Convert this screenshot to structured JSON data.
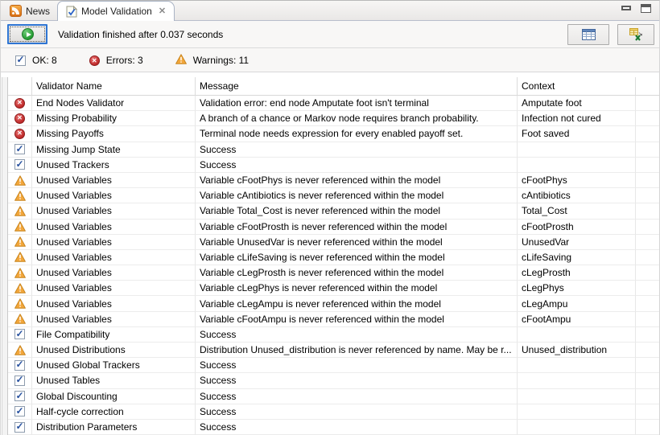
{
  "colors": {
    "focus_blue": "#2E75D3",
    "error_red": "#BE2929",
    "warning_orange": "#F3A73B",
    "ok_check_navy": "#27519F",
    "panel_bg": "#F8F7F6"
  },
  "icons": {
    "ok": "ok-checkbox-icon",
    "error": "error-icon",
    "warning": "warning-icon"
  },
  "tabs": {
    "news": {
      "label": "News"
    },
    "model_validation": {
      "label": "Model Validation"
    }
  },
  "toolbar": {
    "status_text": "Validation finished after 0.037 seconds"
  },
  "summary": {
    "ok_label": "OK: 8",
    "errors_label": "Errors: 3",
    "warnings_label": "Warnings: 11"
  },
  "table": {
    "columns": [
      "Validator Name",
      "Message",
      "Context"
    ],
    "rows": [
      {
        "status": "error",
        "name": "End Nodes Validator",
        "message": "Validation error: end node Amputate foot isn't terminal",
        "context": "Amputate foot"
      },
      {
        "status": "error",
        "name": "Missing Probability",
        "message": "A branch of a chance or Markov node requires branch probability.",
        "context": "Infection not cured"
      },
      {
        "status": "error",
        "name": "Missing Payoffs",
        "message": "Terminal node needs expression for every enabled payoff set.",
        "context": "Foot saved"
      },
      {
        "status": "ok",
        "name": "Missing Jump State",
        "message": "Success",
        "context": ""
      },
      {
        "status": "ok",
        "name": "Unused Trackers",
        "message": "Success",
        "context": ""
      },
      {
        "status": "warning",
        "name": "Unused Variables",
        "message": "Variable cFootPhys is never referenced within the model",
        "context": "cFootPhys"
      },
      {
        "status": "warning",
        "name": "Unused Variables",
        "message": "Variable cAntibiotics is never referenced within the model",
        "context": "cAntibiotics"
      },
      {
        "status": "warning",
        "name": "Unused Variables",
        "message": "Variable Total_Cost is never referenced within the model",
        "context": "Total_Cost"
      },
      {
        "status": "warning",
        "name": "Unused Variables",
        "message": "Variable cFootProsth is never referenced within the model",
        "context": "cFootProsth"
      },
      {
        "status": "warning",
        "name": "Unused Variables",
        "message": "Variable UnusedVar is never referenced within the model",
        "context": "UnusedVar"
      },
      {
        "status": "warning",
        "name": "Unused Variables",
        "message": "Variable cLifeSaving is never referenced within the model",
        "context": "cLifeSaving"
      },
      {
        "status": "warning",
        "name": "Unused Variables",
        "message": "Variable cLegProsth is never referenced within the model",
        "context": "cLegProsth"
      },
      {
        "status": "warning",
        "name": "Unused Variables",
        "message": "Variable cLegPhys is never referenced within the model",
        "context": "cLegPhys"
      },
      {
        "status": "warning",
        "name": "Unused Variables",
        "message": "Variable cLegAmpu is never referenced within the model",
        "context": "cLegAmpu"
      },
      {
        "status": "warning",
        "name": "Unused Variables",
        "message": "Variable cFootAmpu is never referenced within the model",
        "context": "cFootAmpu"
      },
      {
        "status": "ok",
        "name": "File Compatibility",
        "message": "Success",
        "context": ""
      },
      {
        "status": "warning",
        "name": "Unused Distributions",
        "message": "Distribution Unused_distribution is never referenced by name. May be r...",
        "context": "Unused_distribution"
      },
      {
        "status": "ok",
        "name": "Unused Global Trackers",
        "message": "Success",
        "context": ""
      },
      {
        "status": "ok",
        "name": "Unused Tables",
        "message": "Success",
        "context": ""
      },
      {
        "status": "ok",
        "name": "Global Discounting",
        "message": "Success",
        "context": ""
      },
      {
        "status": "ok",
        "name": "Half-cycle correction",
        "message": "Success",
        "context": ""
      },
      {
        "status": "ok",
        "name": "Distribution Parameters",
        "message": "Success",
        "context": ""
      }
    ]
  }
}
